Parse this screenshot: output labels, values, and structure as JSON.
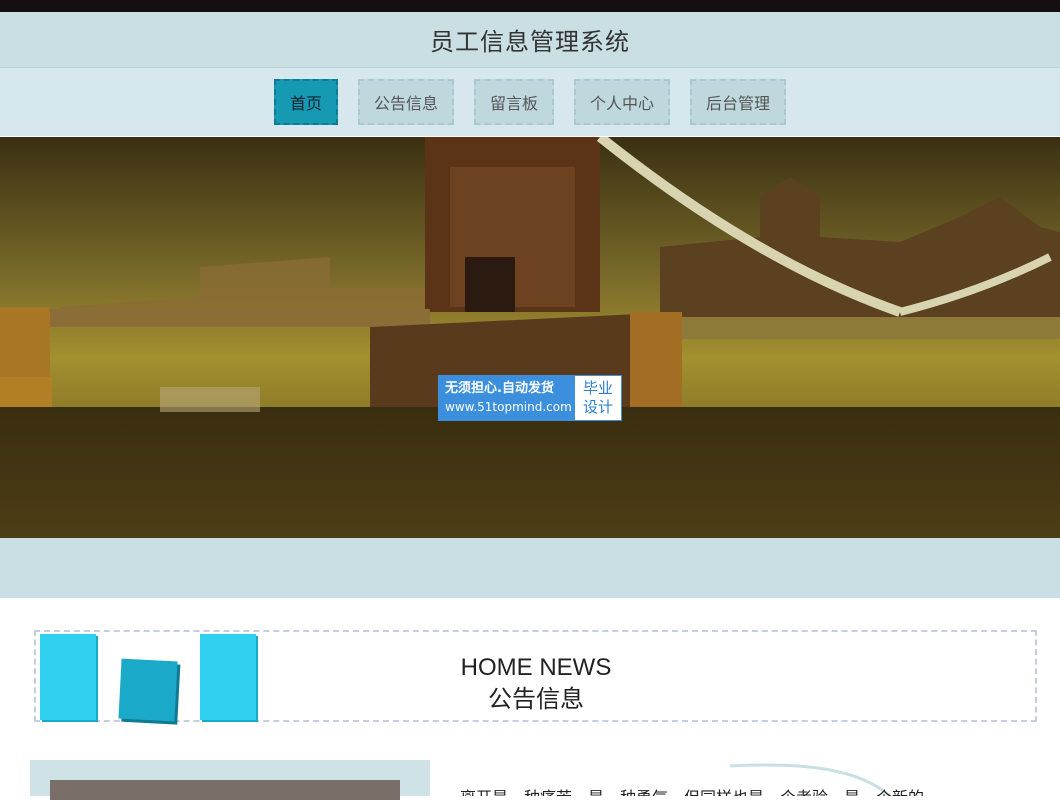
{
  "header": {
    "title": "员工信息管理系统"
  },
  "nav": {
    "items": [
      {
        "label": "首页",
        "active": true
      },
      {
        "label": "公告信息",
        "active": false
      },
      {
        "label": "留言板",
        "active": false
      },
      {
        "label": "个人中心",
        "active": false
      },
      {
        "label": "后台管理",
        "active": false
      }
    ]
  },
  "banner": {
    "image": "tower-bridge-photo",
    "watermark": {
      "line1": "无须担心.自动发货",
      "line2": "www.51topmind.com",
      "right_line1": "毕业",
      "right_line2": "设计"
    }
  },
  "section": {
    "title_en": "HOME NEWS",
    "title_cn": "公告信息"
  },
  "notice": {
    "text": "离开是一种痛苦，是一种勇气，但同样也是一个考验，是一个新的"
  },
  "colors": {
    "accent": "#1699b3",
    "header_bg": "#c9dfe4",
    "nav_bg": "#d6e8ee",
    "watermark_blue": "#3b8fdc",
    "deco_cyan": "#2fd0f0"
  }
}
